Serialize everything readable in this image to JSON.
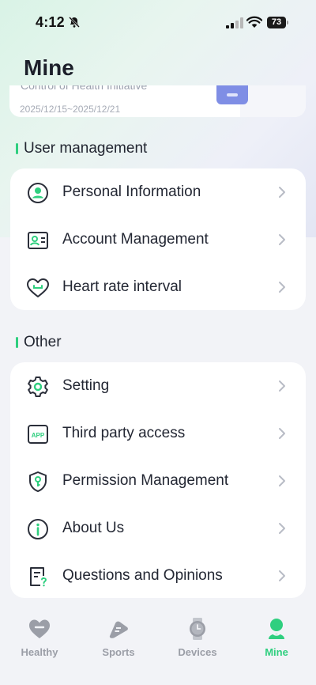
{
  "status_bar": {
    "time": "4:12",
    "battery": "73"
  },
  "page": {
    "title": "Mine"
  },
  "report_card": {
    "title_partial": "Control of Health Initiative",
    "date_range": "2025/12/15~2025/12/21"
  },
  "sections": {
    "user_management": {
      "label": "User management",
      "items": [
        {
          "label": "Personal Information",
          "icon": "user-icon"
        },
        {
          "label": "Account Management",
          "icon": "id-card-icon"
        },
        {
          "label": "Heart rate interval",
          "icon": "heart-icon"
        }
      ]
    },
    "other": {
      "label": "Other",
      "items": [
        {
          "label": "Setting",
          "icon": "gear-icon"
        },
        {
          "label": "Third party access",
          "icon": "app-icon",
          "icon_text": "APP"
        },
        {
          "label": "Permission Management",
          "icon": "shield-key-icon"
        },
        {
          "label": "About Us",
          "icon": "info-icon"
        },
        {
          "label": "Questions and Opinions",
          "icon": "feedback-icon"
        }
      ]
    }
  },
  "tabbar": {
    "tabs": [
      {
        "label": "Healthy",
        "active": false
      },
      {
        "label": "Sports",
        "active": false
      },
      {
        "label": "Devices",
        "active": false
      },
      {
        "label": "Mine",
        "active": true
      }
    ]
  },
  "colors": {
    "accent": "#2fcf7f",
    "icon_stroke": "#2b2f3a",
    "chevron": "#b8bcc6",
    "inactive_tab": "#9b9ea7"
  }
}
